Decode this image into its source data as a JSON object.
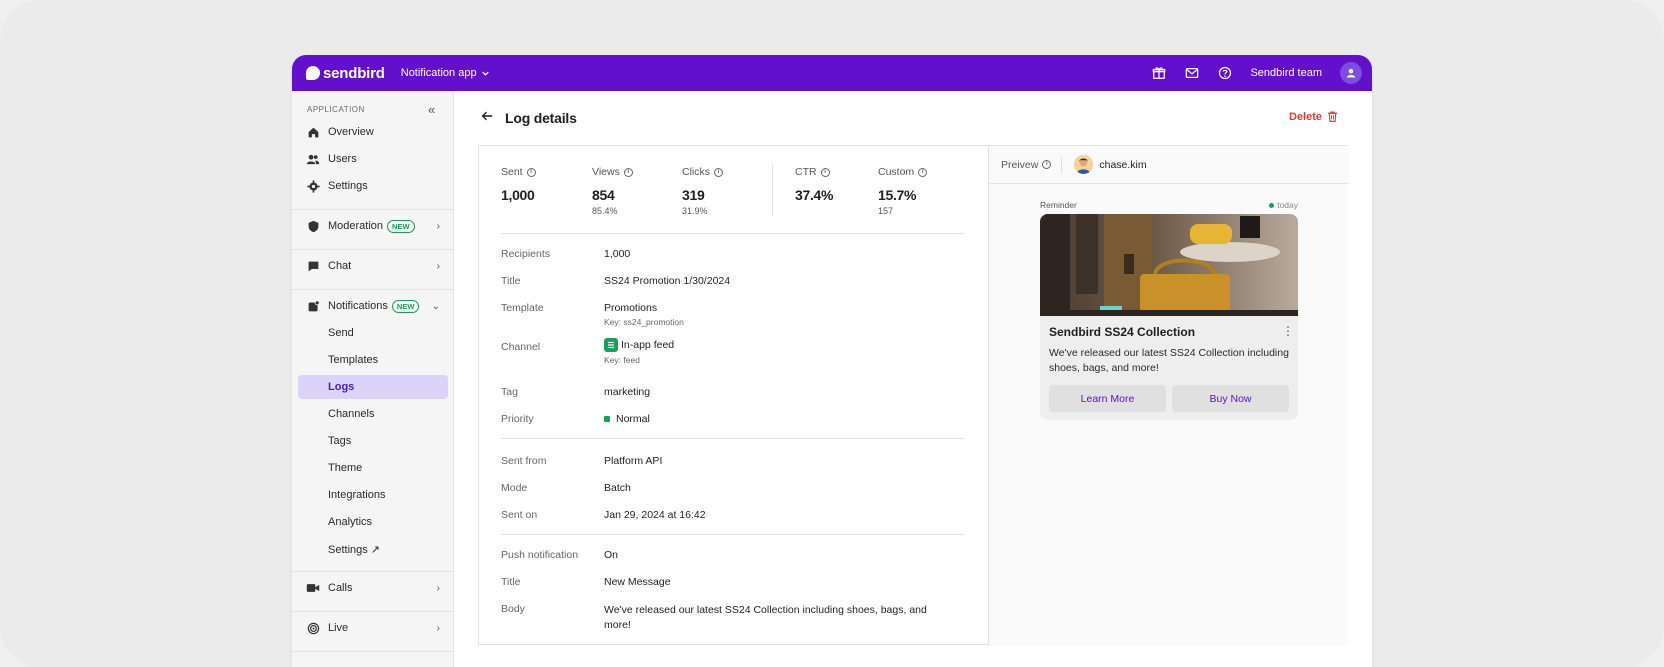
{
  "topbar": {
    "brand": "sendbird",
    "app_name": "Notification app",
    "team_name": "Sendbird team",
    "icons": [
      "gift-icon",
      "mail-icon",
      "help-icon",
      "user-icon"
    ],
    "color": "#6210cc"
  },
  "sidebar": {
    "section_label": "APPLICATION",
    "items": [
      {
        "label": "Overview",
        "icon": "home-icon"
      },
      {
        "label": "Users",
        "icon": "users-icon"
      },
      {
        "label": "Settings",
        "icon": "gear-icon"
      },
      {
        "label": "Moderation",
        "icon": "shield-icon",
        "badge": "NEW"
      },
      {
        "label": "Chat",
        "icon": "chat-icon"
      },
      {
        "label": "Notifications",
        "icon": "notification-icon",
        "badge": "NEW"
      },
      {
        "label": "Calls",
        "icon": "video-icon"
      },
      {
        "label": "Live",
        "icon": "live-icon"
      }
    ],
    "sub_items": [
      {
        "label": "Send"
      },
      {
        "label": "Templates"
      },
      {
        "label": "Logs",
        "active": true
      },
      {
        "label": "Channels"
      },
      {
        "label": "Tags"
      },
      {
        "label": "Theme"
      },
      {
        "label": "Integrations"
      },
      {
        "label": "Analytics"
      },
      {
        "label": "Settings ↗"
      }
    ]
  },
  "header": {
    "title": "Log details",
    "delete_label": "Delete"
  },
  "stats": [
    {
      "label": "Sent",
      "value": "1,000",
      "sub": ""
    },
    {
      "label": "Views",
      "value": "854",
      "sub": "85.4%"
    },
    {
      "label": "Clicks",
      "value": "319",
      "sub": "31.9%"
    },
    {
      "label": "CTR",
      "value": "37.4%",
      "sub": ""
    },
    {
      "label": "Custom",
      "value": "15.7%",
      "sub": "157"
    }
  ],
  "details": {
    "recipients": {
      "label": "Recipients",
      "value": "1,000"
    },
    "title": {
      "label": "Title",
      "value": "SS24 Promotion 1/30/2024"
    },
    "template": {
      "label": "Template",
      "value": "Promotions",
      "key": "Key: ss24_promotion"
    },
    "channel": {
      "label": "Channel",
      "value": "In-app feed",
      "key": "Key: feed"
    },
    "tag": {
      "label": "Tag",
      "value": "marketing"
    },
    "priority": {
      "label": "Priority",
      "value": "Normal"
    },
    "sent_from": {
      "label": "Sent from",
      "value": "Platform API"
    },
    "mode": {
      "label": "Mode",
      "value": "Batch"
    },
    "sent_on": {
      "label": "Sent on",
      "value": "Jan 29, 2024 at 16:42"
    },
    "push": {
      "label": "Push notification",
      "value": "On"
    },
    "push_title": {
      "label": "Title",
      "value": "New Message"
    },
    "push_body": {
      "label": "Body",
      "value": "We've released our latest SS24 Collection including shoes, bags, and more!"
    }
  },
  "preview": {
    "label": "Preivew",
    "user": "chase.kim",
    "card": {
      "category": "Reminder",
      "time": "today",
      "title": "Sendbird SS24 Collection",
      "body": "We've released our latest SS24 Collection including shoes, bags, and more!",
      "button_1": "Learn More",
      "button_2": "Buy Now"
    }
  }
}
